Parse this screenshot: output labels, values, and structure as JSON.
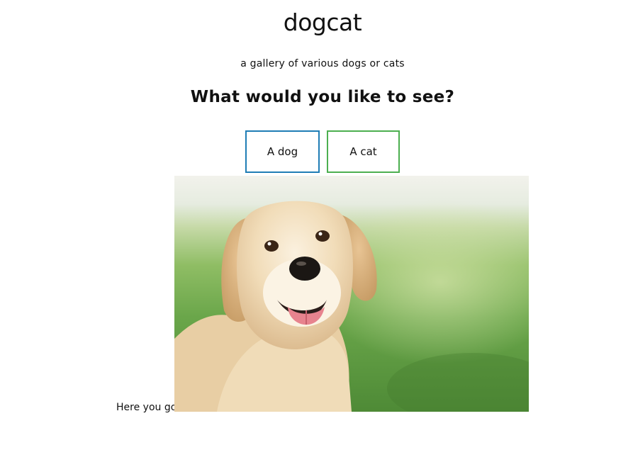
{
  "header": {
    "title": "dogcat",
    "subtitle": "a gallery of various dogs or cats"
  },
  "prompt": {
    "question": "What would you like to see?"
  },
  "buttons": {
    "dog_label": "A dog",
    "cat_label": "A cat",
    "dog_border_color": "#1f7db5",
    "cat_border_color": "#4caf50"
  },
  "result": {
    "caption": "Here you go!",
    "image_subject": "golden retriever dog sitting on grass"
  }
}
